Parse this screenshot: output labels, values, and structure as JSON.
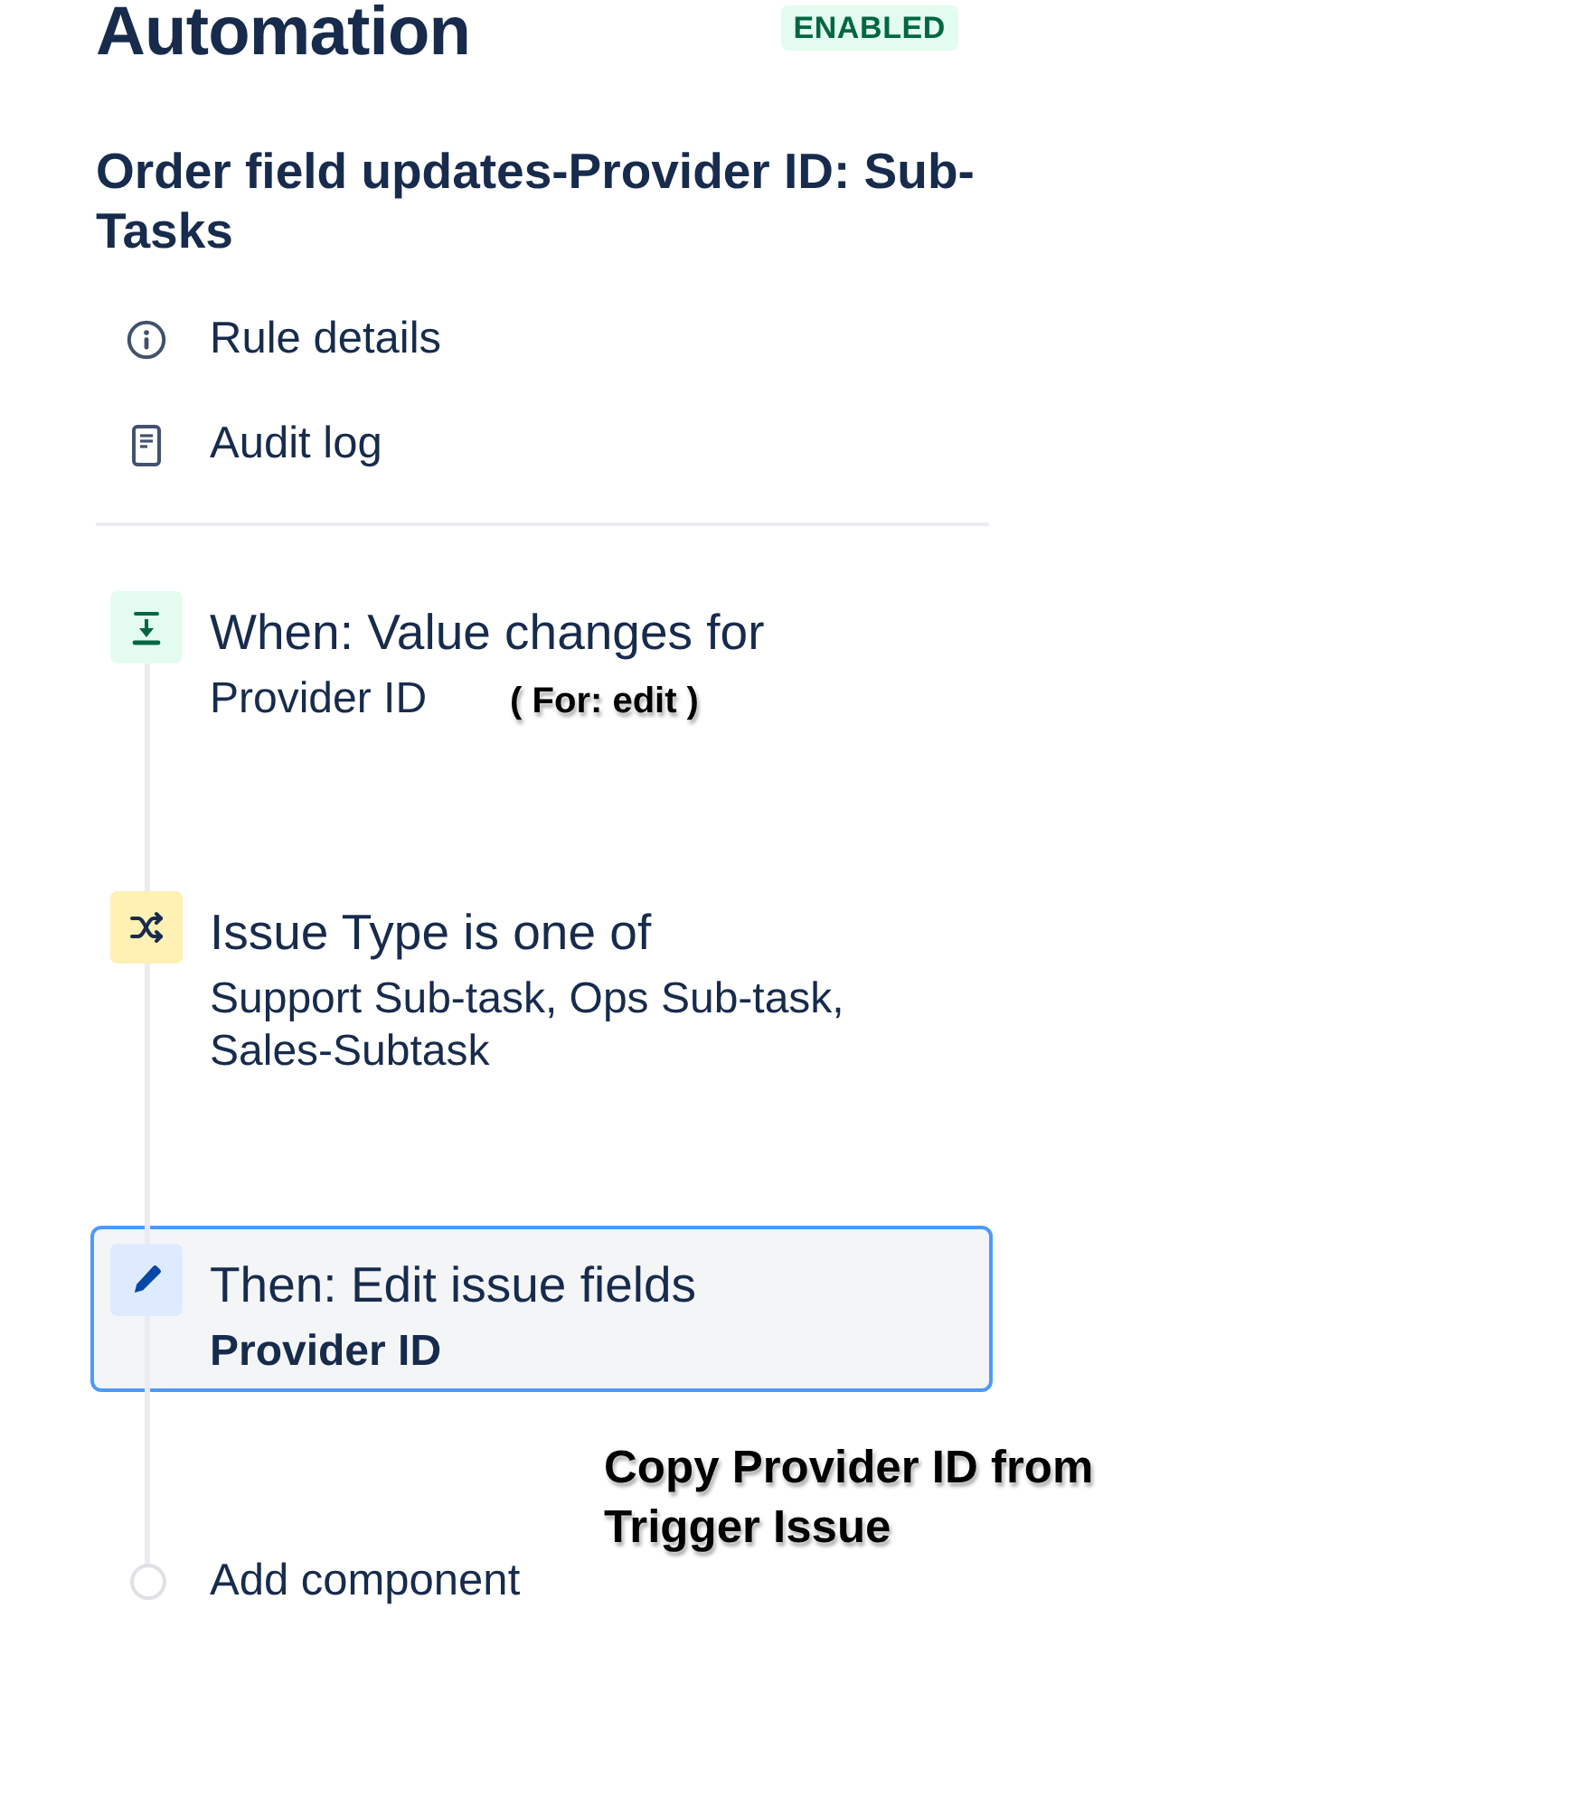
{
  "header": {
    "title": "Automation",
    "status": {
      "label": "ENABLED",
      "enabled": true
    }
  },
  "rule": {
    "name": "Order field updates-Provider ID: Sub-Tasks"
  },
  "menu": [
    {
      "kind": "info",
      "label": "Rule details"
    },
    {
      "kind": "log",
      "label": "Audit log"
    }
  ],
  "components": [
    {
      "kind": "trigger",
      "title": "When: Value changes for",
      "detail": "Provider ID",
      "selected": false,
      "note": {
        "kind": "inline",
        "text": "( For: edit )"
      }
    },
    {
      "kind": "condition",
      "title": "Issue Type is one of",
      "detail": "Support Sub-task, Ops Sub-task, Sales-Subtask",
      "selected": false
    },
    {
      "kind": "action",
      "title": "Then: Edit issue fields",
      "detail": "Provider ID",
      "selected": true,
      "note": {
        "kind": "below",
        "text": "Copy Provider ID from Trigger Issue"
      }
    }
  ],
  "add_component": {
    "label": "Add component"
  }
}
